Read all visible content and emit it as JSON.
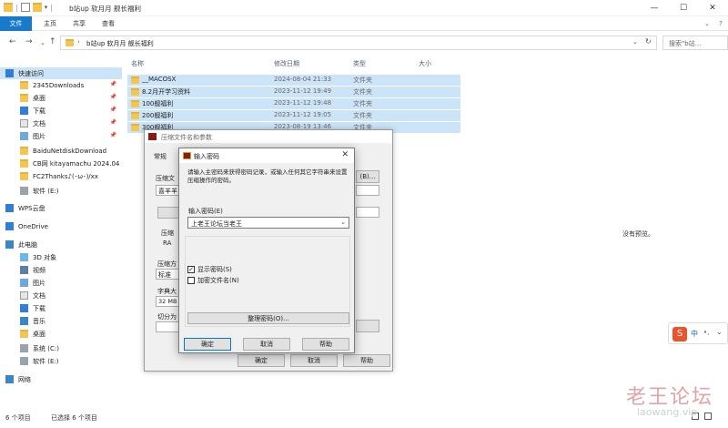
{
  "window": {
    "title": "b站up 软月月 舰长福利",
    "minimize": "—",
    "maximize": "☐",
    "close": "✕"
  },
  "ribbon": {
    "tabs": [
      "文件",
      "主页",
      "共享",
      "查看"
    ]
  },
  "address": {
    "path": "b站up 软月月 舰长福利",
    "search_placeholder": "搜索\"b站..."
  },
  "nav": {
    "items": [
      {
        "label": "快速访问",
        "icon": "star-icon",
        "pinned": false
      },
      {
        "label": "2345Downloads",
        "icon": "folder-icon",
        "pinned": true
      },
      {
        "label": "桌面",
        "icon": "folder-icon",
        "pinned": true
      },
      {
        "label": "下载",
        "icon": "download-icon",
        "pinned": true
      },
      {
        "label": "文档",
        "icon": "document-icon",
        "pinned": true
      },
      {
        "label": "图片",
        "icon": "picture-icon",
        "pinned": true
      },
      {
        "label": "BaiduNetdiskDownload",
        "icon": "folder-icon",
        "pinned": false
      },
      {
        "label": "CB网 kitayamachu 2024.04",
        "icon": "folder-icon",
        "pinned": false
      },
      {
        "label": "FC2Thanks♪(･ω･)/xx",
        "icon": "folder-icon",
        "pinned": false
      },
      {
        "label": "软件 (E:)",
        "icon": "drive-icon",
        "pinned": false
      },
      {
        "label": "WPS云盘",
        "icon": "cloud-icon",
        "pinned": false
      },
      {
        "label": "OneDrive",
        "icon": "cloud-icon",
        "pinned": false
      },
      {
        "label": "此电脑",
        "icon": "computer-icon",
        "pinned": false
      },
      {
        "label": "3D 对象",
        "icon": "cube-icon",
        "pinned": false
      },
      {
        "label": "视频",
        "icon": "video-icon",
        "pinned": false
      },
      {
        "label": "图片",
        "icon": "picture-icon",
        "pinned": false
      },
      {
        "label": "文档",
        "icon": "document-icon",
        "pinned": false
      },
      {
        "label": "下载",
        "icon": "download-icon",
        "pinned": false
      },
      {
        "label": "音乐",
        "icon": "music-icon",
        "pinned": false
      },
      {
        "label": "桌面",
        "icon": "folder-icon",
        "pinned": false
      },
      {
        "label": "系统 (C:)",
        "icon": "drive-icon",
        "pinned": false
      },
      {
        "label": "软件 (E:)",
        "icon": "drive-icon",
        "pinned": false
      },
      {
        "label": "网络",
        "icon": "network-icon",
        "pinned": false
      }
    ]
  },
  "files": {
    "columns": [
      "名称",
      "修改日期",
      "类型",
      "大小"
    ],
    "rows": [
      {
        "name": "__MACOSX",
        "date": "2024-08-04 21:33",
        "type": "文件夹"
      },
      {
        "name": "8.2月开学习资料",
        "date": "2023-11-12 19:49",
        "type": "文件夹"
      },
      {
        "name": "100舰福利",
        "date": "2023-11-12 19:48",
        "type": "文件夹"
      },
      {
        "name": "200舰福利",
        "date": "2023-11-12 19:05",
        "type": "文件夹"
      },
      {
        "name": "300舰福利",
        "date": "2023-08-19 13:46",
        "type": "文件夹"
      }
    ]
  },
  "preview": {
    "empty_text": "没有预览。"
  },
  "status": {
    "count": "6 个项目",
    "selected": "已选择 6 个项目"
  },
  "back_dialog": {
    "title": "压缩文件名和参数",
    "tab": "常规",
    "labels": [
      "压缩文",
      "压缩方",
      "标准",
      "字典大",
      "32 MB",
      "切分为",
      "压缩",
      "RA"
    ],
    "field": "喜羊羊",
    "browse": "(B)...",
    "ok": "确定",
    "cancel": "取消",
    "help": "帮助"
  },
  "password_dialog": {
    "title": "输入密码",
    "prompt": "请输入主密码来获得密码记录，或输入任何其它字符串来设置压缩操作的密码。",
    "password_label": "输入密码(E)",
    "password_value": "上老王论坛当老王",
    "show_password": "显示密码(S)",
    "show_password_checked": true,
    "encrypt_filenames": "加密文件名(N)",
    "encrypt_filenames_checked": false,
    "manage": "整理密码(O)...",
    "ok": "确定",
    "cancel": "取消",
    "help": "帮助"
  },
  "ime": {
    "lang": "中",
    "sep": "•,",
    "icon": "sogou-icon"
  },
  "watermark": {
    "title": "老王论坛",
    "url": "laowang.vip"
  },
  "colors": {
    "accent": "#1979ca",
    "selection": "#cce4f7",
    "folder": "#f3c552"
  }
}
